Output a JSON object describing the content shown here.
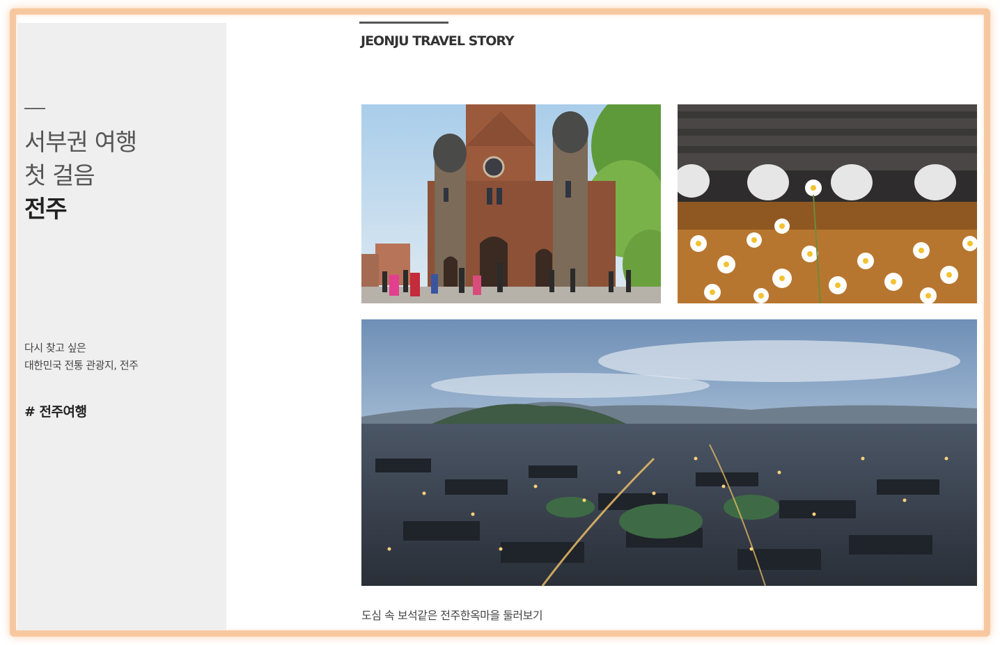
{
  "sidebar": {
    "headline_line1": "서부권 여행",
    "headline_line2": "첫 걸음",
    "headline_bold": "전주",
    "description_line1": "다시 찾고 싶은",
    "description_line2": "대한민국 전통 관광지, 전주",
    "hashtag": "# 전주여행"
  },
  "main": {
    "section_title": "JEONJU TRAVEL STORY",
    "caption": "도심 속 보석같은 전주한옥마을 둘러보기"
  },
  "colors": {
    "sidebar_bg": "#efefef",
    "frame_border": "#f7c8a0",
    "text_dark": "#222222"
  }
}
